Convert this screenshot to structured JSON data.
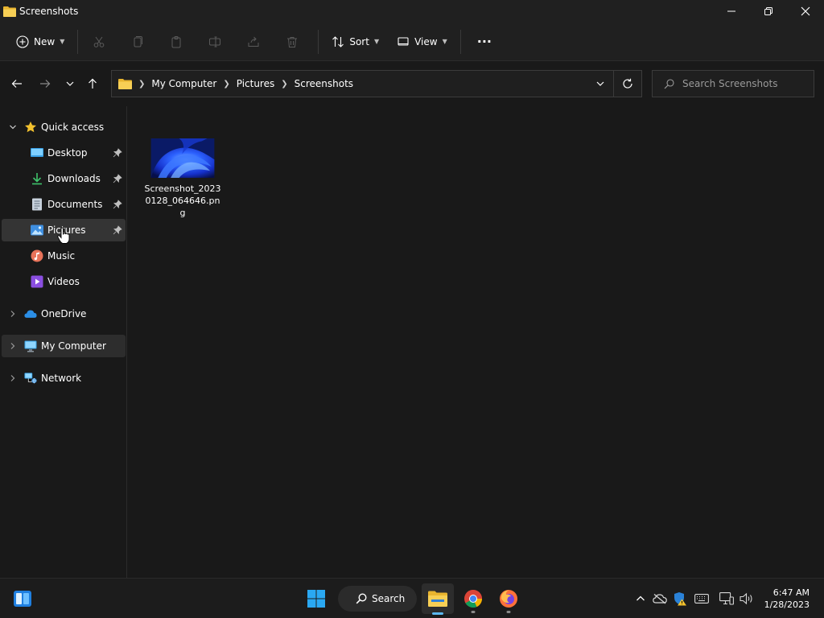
{
  "window": {
    "title": "Screenshots"
  },
  "toolbar": {
    "new_label": "New",
    "sort_label": "Sort",
    "view_label": "View",
    "more_label": "···"
  },
  "address": {
    "crumbs": [
      "My Computer",
      "Pictures",
      "Screenshots"
    ]
  },
  "search": {
    "placeholder": "Search Screenshots"
  },
  "sidebar": {
    "quick_access": "Quick access",
    "items": [
      {
        "label": "Desktop",
        "icon": "desktop-icon",
        "pinned": true
      },
      {
        "label": "Downloads",
        "icon": "download-icon",
        "pinned": true
      },
      {
        "label": "Documents",
        "icon": "documents-icon",
        "pinned": true
      },
      {
        "label": "Pictures",
        "icon": "pictures-icon",
        "pinned": true
      },
      {
        "label": "Music",
        "icon": "music-icon",
        "pinned": false
      },
      {
        "label": "Videos",
        "icon": "videos-icon",
        "pinned": false
      }
    ],
    "onedrive": "OneDrive",
    "my_computer": "My Computer",
    "network": "Network"
  },
  "files": [
    {
      "name": "Screenshot_20230128_064646.png"
    }
  ],
  "taskbar": {
    "search_label": "Search",
    "time": "6:47 AM",
    "date": "1/28/2023"
  },
  "colors": {
    "background": "#191919",
    "chrome": "#202020",
    "accent": "#5cb8f0",
    "folder": "#f3c33f"
  }
}
